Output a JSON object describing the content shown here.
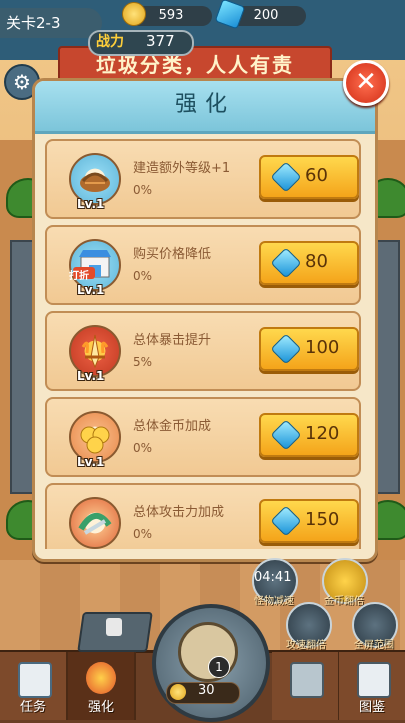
{
  "hud": {
    "level": "关卡2-3",
    "coins": "593",
    "gems": "200",
    "power_label": "战力",
    "power_value": "377"
  },
  "scene": {
    "banner": "垃圾分类，人人有责"
  },
  "dialog": {
    "title": "强化",
    "close_icon": "close-x-icon",
    "items": [
      {
        "icon": "basket-icon",
        "level": "Lv.1",
        "name": "建造额外等级+1",
        "percent": "0%",
        "price": "60"
      },
      {
        "icon": "shop-discount-icon",
        "badge": "打折",
        "level": "Lv.1",
        "name": "购买价格降低",
        "percent": "0%",
        "price": "80"
      },
      {
        "icon": "flame-sword-icon",
        "level": "Lv.1",
        "name": "总体暴击提升",
        "percent": "5%",
        "price": "100"
      },
      {
        "icon": "gold-coins-icon",
        "level": "Lv.1",
        "name": "总体金币加成",
        "percent": "0%",
        "price": "120"
      },
      {
        "icon": "attack-icon",
        "level": "",
        "name": "总体攻击力加成",
        "percent": "0%",
        "price": "150"
      }
    ]
  },
  "skills": {
    "timer": "04:41",
    "slow": "怪物减速",
    "gold_double": "金币翻倍",
    "attack_double": "攻速翻倍",
    "full_range": "全屏范围"
  },
  "bottom": {
    "tasks": "任务",
    "upgrade": "强化",
    "shop": "",
    "gallery": "图鉴",
    "center_badge": "1",
    "center_cost": "30"
  },
  "colors": {
    "accent_gold": "#f4a41a",
    "dialog_bg": "#f6e7c8",
    "header_blue": "#7cc5da",
    "close_red": "#d12e16"
  }
}
